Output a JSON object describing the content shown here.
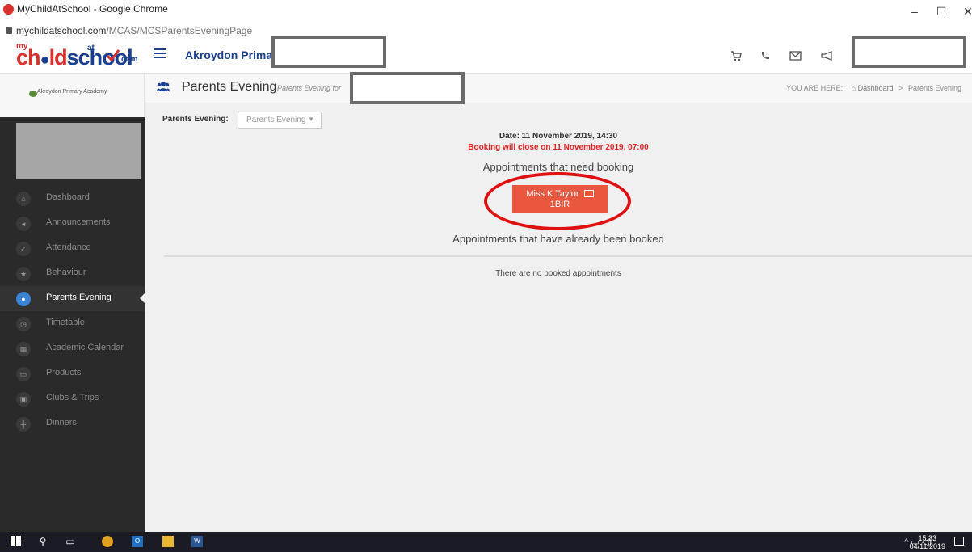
{
  "window": {
    "title": "MyChildAtSchool - Google Chrome",
    "minimize": "–",
    "maximize": "☐",
    "close": "✕"
  },
  "address_bar": {
    "host": "mychildatschool.com",
    "path": "/MCAS/MCSParentsEveningPage"
  },
  "logo": {
    "my": "my",
    "ch": "ch",
    "ld": "ld",
    "school": "school",
    "at": "at",
    "com": "com"
  },
  "header": {
    "school_name": "Akroydon Prima",
    "icons": [
      "cart-icon",
      "phone-icon",
      "mail-icon",
      "megaphone-icon"
    ]
  },
  "sidebar": {
    "school_name": "Akroydon Primary Academy",
    "items": [
      {
        "label": "Dashboard",
        "icon": "home-icon",
        "active": false
      },
      {
        "label": "Announcements",
        "icon": "megaphone-icon",
        "active": false
      },
      {
        "label": "Attendance",
        "icon": "check-icon",
        "active": false
      },
      {
        "label": "Behaviour",
        "icon": "star-icon",
        "active": false
      },
      {
        "label": "Parents Evening",
        "icon": "users-icon",
        "active": true
      },
      {
        "label": "Timetable",
        "icon": "clock-icon",
        "active": false
      },
      {
        "label": "Academic Calendar",
        "icon": "calendar-icon",
        "active": false
      },
      {
        "label": "Products",
        "icon": "card-icon",
        "active": false
      },
      {
        "label": "Clubs & Trips",
        "icon": "bus-icon",
        "active": false
      },
      {
        "label": "Dinners",
        "icon": "cutlery-icon",
        "active": false
      }
    ]
  },
  "page": {
    "title": "Parents Evening",
    "subtitle": "Parents Evening for",
    "you_are_here": "YOU ARE HERE:",
    "breadcrumb_dashboard": "Dashboard",
    "breadcrumb_sep": ">",
    "breadcrumb_current": "Parents Evening"
  },
  "content": {
    "select_label": "Parents Evening:",
    "select_value": "Parents Evening",
    "date": "Date: 11 November 2019, 14:30",
    "closing": "Booking will close on 11 November 2019, 07:00",
    "need_booking_heading": "Appointments that need booking",
    "appointment": {
      "teacher": "Miss K Taylor",
      "class": "1BIR"
    },
    "booked_heading": "Appointments that have already been booked",
    "no_booked": "There are no booked appointments"
  },
  "colors": {
    "brand_blue": "#1a3f8f",
    "brand_red": "#d9302c",
    "appointment_button": "#e9573f",
    "annotation_circle": "#e01010",
    "sidebar_bg": "#2a2a2a"
  },
  "taskbar": {
    "icons": [
      "windows-start-icon",
      "search-icon",
      "task-view-icon",
      "chrome-icon",
      "outlook-icon",
      "file-explorer-icon",
      "word-icon"
    ],
    "time": "15:33",
    "date": "04/11/2019"
  }
}
